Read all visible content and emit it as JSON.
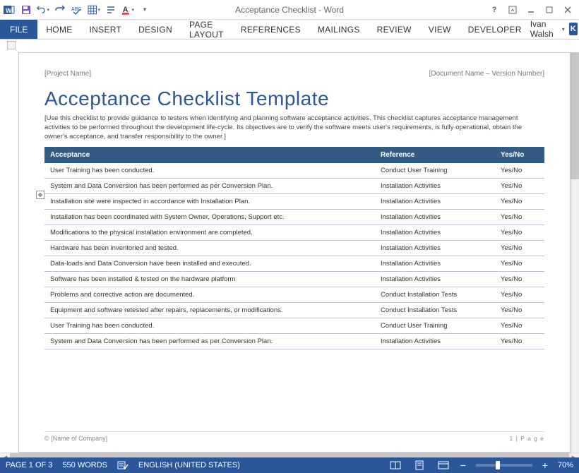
{
  "titlebar": {
    "appTitle": "Acceptance Checklist - Word"
  },
  "ribbon": {
    "file": "FILE",
    "tabs": [
      "HOME",
      "INSERT",
      "DESIGN",
      "PAGE LAYOUT",
      "REFERENCES",
      "MAILINGS",
      "REVIEW",
      "VIEW",
      "DEVELOPER"
    ],
    "user": "Ivan Walsh",
    "userInitial": "K"
  },
  "document": {
    "header": {
      "left": "[Project Name]",
      "right": "[Document Name – Version Number]"
    },
    "title": "Acceptance Checklist Template",
    "intro": "[Use this checklist to provide guidance to testers when identifying and planning software acceptance activities. This checklist captures acceptance management activities to be performed throughout the development life-cycle. Its objectives are to verify the software meets user's requirements, is fully operational, obtain the owner's acceptance, and transfer responsibility to the owner.]",
    "columns": [
      "Acceptance",
      "Reference",
      "Yes/No"
    ],
    "rows": [
      {
        "a": "User Training has been conducted.",
        "r": "Conduct User Training",
        "y": "Yes/No"
      },
      {
        "a": "System and Data Conversion has been performed as per Conversion Plan.",
        "r": "Installation Activities",
        "y": "Yes/No"
      },
      {
        "a": "Installation site were inspected in accordance with Installation Plan.",
        "r": "Installation Activities",
        "y": "Yes/No"
      },
      {
        "a": "Installation has been coordinated with System Owner, Operations, Support etc.",
        "r": "Installation Activities",
        "y": "Yes/No"
      },
      {
        "a": "Modifications to the physical installation environment are completed.",
        "r": "Installation Activities",
        "y": "Yes/No"
      },
      {
        "a": "Hardware has been inventoried and tested.",
        "r": "Installation Activities",
        "y": "Yes/No"
      },
      {
        "a": "Data-loads and Data Conversion have been installed and executed.",
        "r": "Installation Activities",
        "y": "Yes/No"
      },
      {
        "a": "Software has been installed & tested on the hardware platform",
        "r": "Installation Activities",
        "y": "Yes/No"
      },
      {
        "a": "Problems and corrective action are documented.",
        "r": "Conduct Installation Tests",
        "y": "Yes/No"
      },
      {
        "a": "Equipment and software retested after repairs, replacements, or modifications.",
        "r": "Conduct Installation Tests",
        "y": "Yes/No"
      },
      {
        "a": "User Training has been conducted.",
        "r": "Conduct User Training",
        "y": "Yes/No"
      },
      {
        "a": "System and Data Conversion has been performed as per Conversion Plan.",
        "r": "Installation Activities",
        "y": "Yes/No"
      }
    ],
    "footer": {
      "left": "© [Name of Company]",
      "right": "1 | P a g e"
    }
  },
  "status": {
    "page": "PAGE 1 OF 3",
    "words": "550 WORDS",
    "lang": "ENGLISH (UNITED STATES)",
    "zoom": "70%"
  }
}
